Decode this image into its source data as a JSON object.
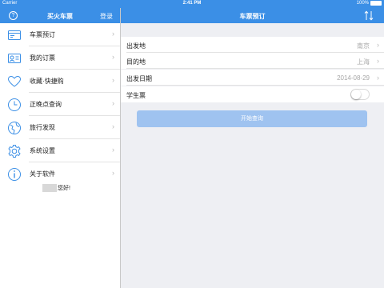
{
  "status_bar": {
    "carrier": "Carrier",
    "time": "2:41 PM",
    "battery": "100%"
  },
  "left_nav": {
    "title": "买火车票",
    "login": "登录",
    "help_glyph": "?"
  },
  "menu": [
    {
      "icon": "ticket-icon",
      "label": "车票预订"
    },
    {
      "icon": "order-card-icon",
      "label": "我的订票"
    },
    {
      "icon": "heart-icon",
      "label": "收藏·快捷购"
    },
    {
      "icon": "clock-icon",
      "label": "正晚点查询"
    },
    {
      "icon": "globe-icon",
      "label": "旅行发现"
    },
    {
      "icon": "gear-icon",
      "label": "系统设置"
    },
    {
      "icon": "info-icon",
      "label": "关于软件"
    }
  ],
  "greeting": "您好!",
  "right_nav": {
    "title": "车票预订"
  },
  "form": {
    "from_label": "出发地",
    "from_value": "南京",
    "to_label": "目的地",
    "to_value": "上海",
    "date_label": "出发日期",
    "date_value": "2014-08-29",
    "student_label": "学生票",
    "student_enabled": false
  },
  "search_button": "开始查询",
  "colors": {
    "nav_blue": "#3b8fe6",
    "button_blue": "#9fc3f0",
    "icon_blue": "#3b8fe6"
  }
}
